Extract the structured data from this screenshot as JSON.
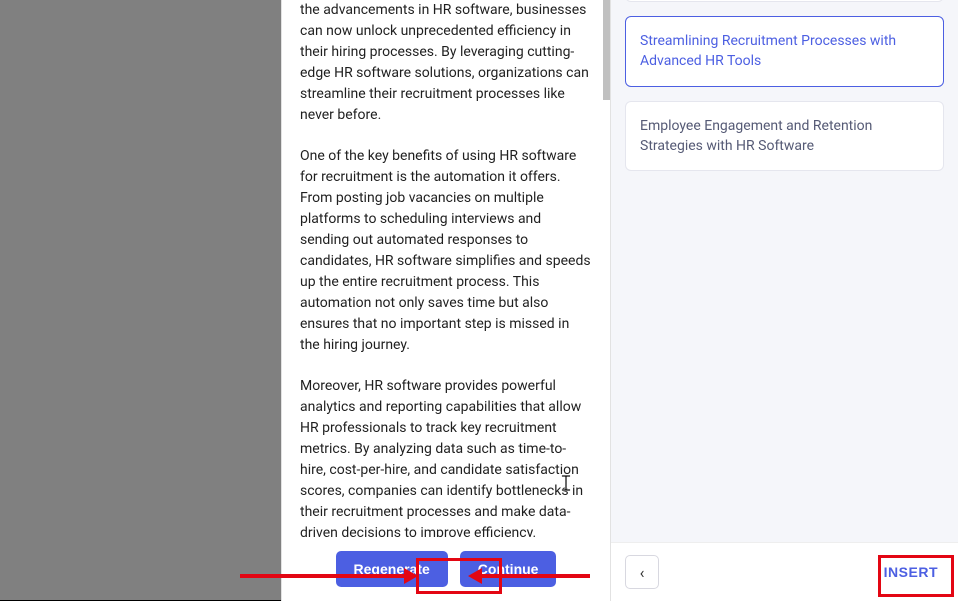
{
  "content": {
    "paragraphs": [
      "the advancements in HR software, businesses can now unlock unprecedented efficiency in their hiring processes. By leveraging cutting-edge HR software solutions, organizations can streamline their recruitment processes like never before.",
      " One of the key benefits of using HR software for recruitment is the automation it offers. From posting job vacancies on multiple platforms to scheduling interviews and sending out automated responses to candidates, HR software simplifies and speeds up the entire recruitment process. This automation not only saves time but also ensures that no important step is missed in the hiring journey.",
      " Moreover, HR software provides powerful analytics and reporting capabilities that allow HR professionals to track key recruitment metrics. By analyzing data such as time-to-hire, cost-per-hire, and candidate satisfaction scores, companies can identify bottlenecks in their recruitment processes and make data-driven decisions to improve efficiency."
    ]
  },
  "buttons": {
    "regenerate": "Regenerate",
    "continue": "Continue",
    "insert": "INSERT"
  },
  "suggestions": {
    "partial_above": "",
    "selected": "Streamlining Recruitment Processes with Advanced HR Tools",
    "second": "Employee Engagement and Retention Strategies with HR Software"
  },
  "icons": {
    "back": "‹"
  }
}
